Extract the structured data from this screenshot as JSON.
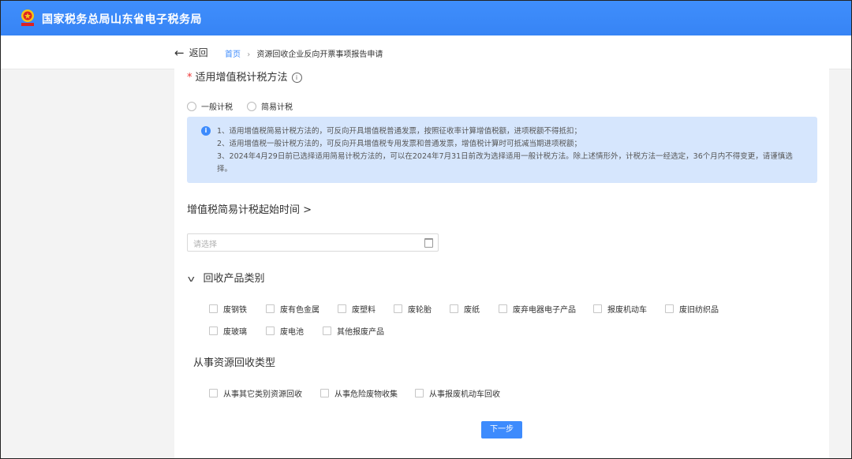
{
  "header": {
    "site_title": "国家税务总局山东省电子税务局",
    "emblem_icon": "tax-emblem-icon",
    "color": "#3d8bfd"
  },
  "nav": {
    "back_label": "返回",
    "breadcrumb": {
      "home": "首页",
      "separator": "›",
      "current": "资源回收企业反向开票事项报告申请"
    }
  },
  "form": {
    "vat_method": {
      "required_mark": "*",
      "label": "适用增值税计税方法",
      "info_icon": "info-icon",
      "options": [
        "一般计税",
        "简易计税"
      ]
    },
    "notice": {
      "icon": "info-filled-icon",
      "lines": [
        "1、适用增值税简易计税方法的，可反向开具增值税普通发票，按照征收率计算增值税额，进项税额不得抵扣；",
        "2、适用增值税一般计税方法的，可反向开具增值税专用发票和普通发票，增值税计算时可抵减当期进项税额；",
        "3、2024年4月29日前已选择适用简易计税方法的，可以在2024年7月31日前改为选择适用一般计税方法。除上述情形外，计税方法一经选定，36个月内不得变更，请谨慎选择。"
      ]
    },
    "start_time": {
      "label": "增值税简易计税起始时间 >",
      "placeholder": "请选择",
      "icon": "calendar-icon"
    },
    "product_category": {
      "label": "回收产品类别",
      "icon": "chevron-down-icon",
      "row1": [
        "废钢铁",
        "废有色金属",
        "废塑料",
        "废轮胎",
        "废纸",
        "废弃电器电子产品",
        "报废机动车",
        "废旧纺织品"
      ],
      "row2": [
        "废玻璃",
        "废电池",
        "其他报废产品"
      ]
    },
    "recycle_type": {
      "label": "从事资源回收类型",
      "options": [
        "从事其它类别资源回收",
        "从事危险废物收集",
        "从事报废机动车回收"
      ]
    },
    "next_button": "下一步"
  }
}
